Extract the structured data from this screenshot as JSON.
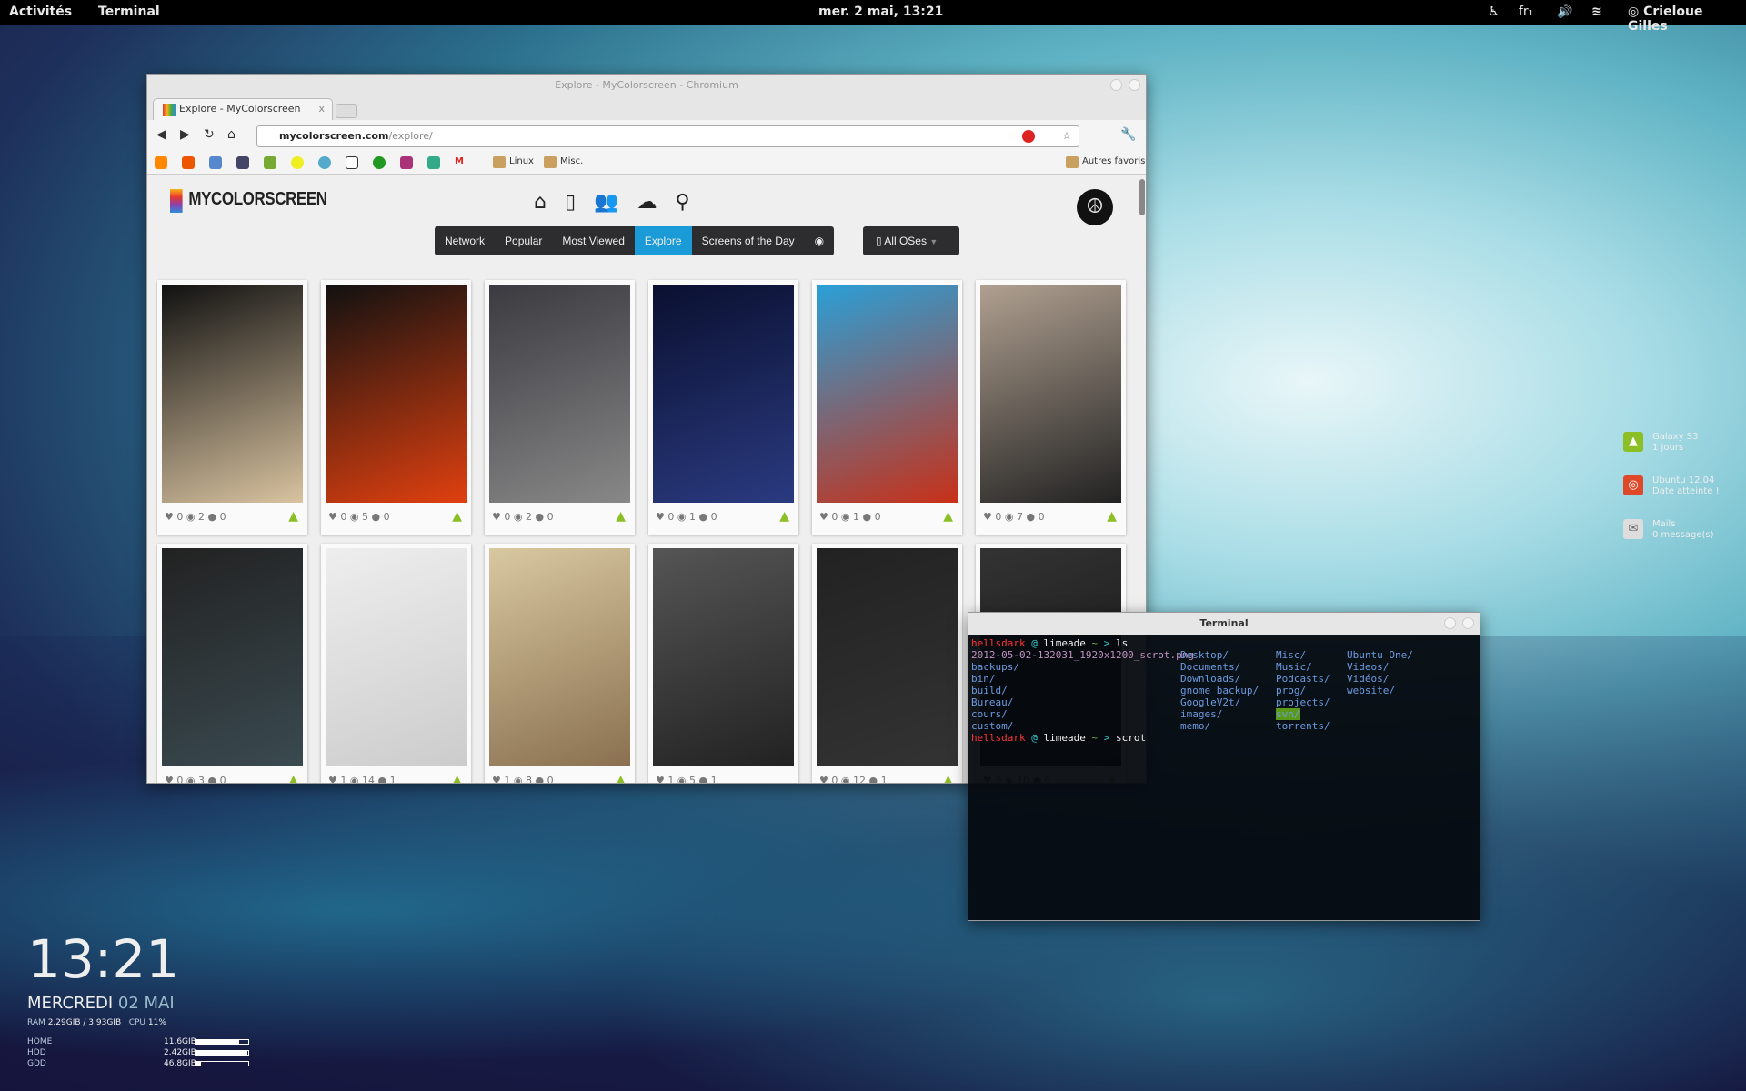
{
  "topbar": {
    "activities": "Activités",
    "app": "Terminal",
    "datetime": "mer.  2 mai, 13:21",
    "keyboard": "fr₁",
    "user": "Crieloue Gilles"
  },
  "browser": {
    "title": "Explore - MyColorscreen - Chromium",
    "tab": "Explore - MyColorscreen",
    "tab_close": "x",
    "url_host": "mycolorscreen.com",
    "url_path": "/explore/",
    "bookmark_folders": [
      "Linux",
      "Misc."
    ],
    "other_bookmarks": "Autres favoris"
  },
  "site": {
    "logo": "MYCOLORSCREEN",
    "nav": [
      "Network",
      "Popular",
      "Most Viewed",
      "Explore",
      "Screens of the Day"
    ],
    "active_nav": "Explore",
    "os_filter": "All OSes",
    "cards": [
      {
        "likes": 0,
        "views": 2,
        "comments": 0,
        "os": "android",
        "colors": [
          "#111",
          "#d9c3a0"
        ]
      },
      {
        "likes": 0,
        "views": 5,
        "comments": 0,
        "os": "android",
        "colors": [
          "#111",
          "#e04010"
        ]
      },
      {
        "likes": 0,
        "views": 2,
        "comments": 0,
        "os": "android",
        "colors": [
          "#3a3a40",
          "#888"
        ]
      },
      {
        "likes": 0,
        "views": 1,
        "comments": 0,
        "os": "android",
        "colors": [
          "#0a1030",
          "#2a3a80"
        ]
      },
      {
        "likes": 0,
        "views": 1,
        "comments": 0,
        "os": "android",
        "colors": [
          "#2aa0d8",
          "#c83018"
        ]
      },
      {
        "likes": 0,
        "views": 7,
        "comments": 0,
        "os": "android",
        "colors": [
          "#b0a090",
          "#222"
        ]
      },
      {
        "likes": 0,
        "views": 3,
        "comments": 0,
        "os": "android",
        "colors": [
          "#222",
          "#3a4a50"
        ]
      },
      {
        "likes": 1,
        "views": 14,
        "comments": 1,
        "os": "android",
        "colors": [
          "#eee",
          "#ccc"
        ]
      },
      {
        "likes": 1,
        "views": 8,
        "comments": 0,
        "os": "android",
        "colors": [
          "#d8c8a0",
          "#8a7050"
        ]
      },
      {
        "likes": 1,
        "views": 5,
        "comments": 1,
        "os": "apple",
        "colors": [
          "#555",
          "#222"
        ]
      },
      {
        "likes": 0,
        "views": 12,
        "comments": 1,
        "os": "android",
        "colors": [
          "#222",
          "#333"
        ]
      },
      {
        "likes": 0,
        "views": 10,
        "comments": 0,
        "os": "android",
        "colors": [
          "#333",
          "#111"
        ]
      }
    ]
  },
  "terminal": {
    "title": "Terminal",
    "user": "hellsdark",
    "host": "limeade",
    "cmd1": "ls",
    "cmd2": "scrot",
    "file": "2012-05-02-132031_1920x1200_scrot.png",
    "col1": [
      "backups/",
      "bin/",
      "build/",
      "Bureau/",
      "cours/",
      "custom/"
    ],
    "col2": [
      "Desktop/",
      "Documents/",
      "Downloads/",
      "gnome_backup/",
      "GoogleV2t/",
      "images/",
      "memo/"
    ],
    "col3": [
      "Misc/",
      "Music/",
      "Podcasts/",
      "prog/",
      "projects/",
      "svn/",
      "torrents/"
    ],
    "col4": [
      "Ubuntu One/",
      "Videos/",
      "Vidéos/",
      "website/"
    ]
  },
  "conky": {
    "time": "13:21",
    "day": "MERCREDI",
    "date": "02 MAI",
    "ram_label": "RAM",
    "ram": "2.29GIB / 3.93GIB",
    "cpu_label": "CPU",
    "cpu": "11%",
    "disks": [
      {
        "name": "HOME",
        "size": "11.6GIB",
        "fill": 0.83
      },
      {
        "name": "HDD",
        "size": "2.42GIB",
        "fill": 0.98
      },
      {
        "name": "GDD",
        "size": "46.8GIB",
        "fill": 0.1
      }
    ]
  },
  "notifications": [
    {
      "title": "Galaxy S3",
      "sub": "1 jours",
      "icon": "android-icon",
      "color": "#8cbf26"
    },
    {
      "title": "Ubuntu 12.04",
      "sub": "Date atteinte !",
      "icon": "ubuntu-icon",
      "color": "#e0482a"
    },
    {
      "title": "Mails",
      "sub": "0 message(s)",
      "icon": "mail-icon",
      "color": "#ddd"
    }
  ]
}
